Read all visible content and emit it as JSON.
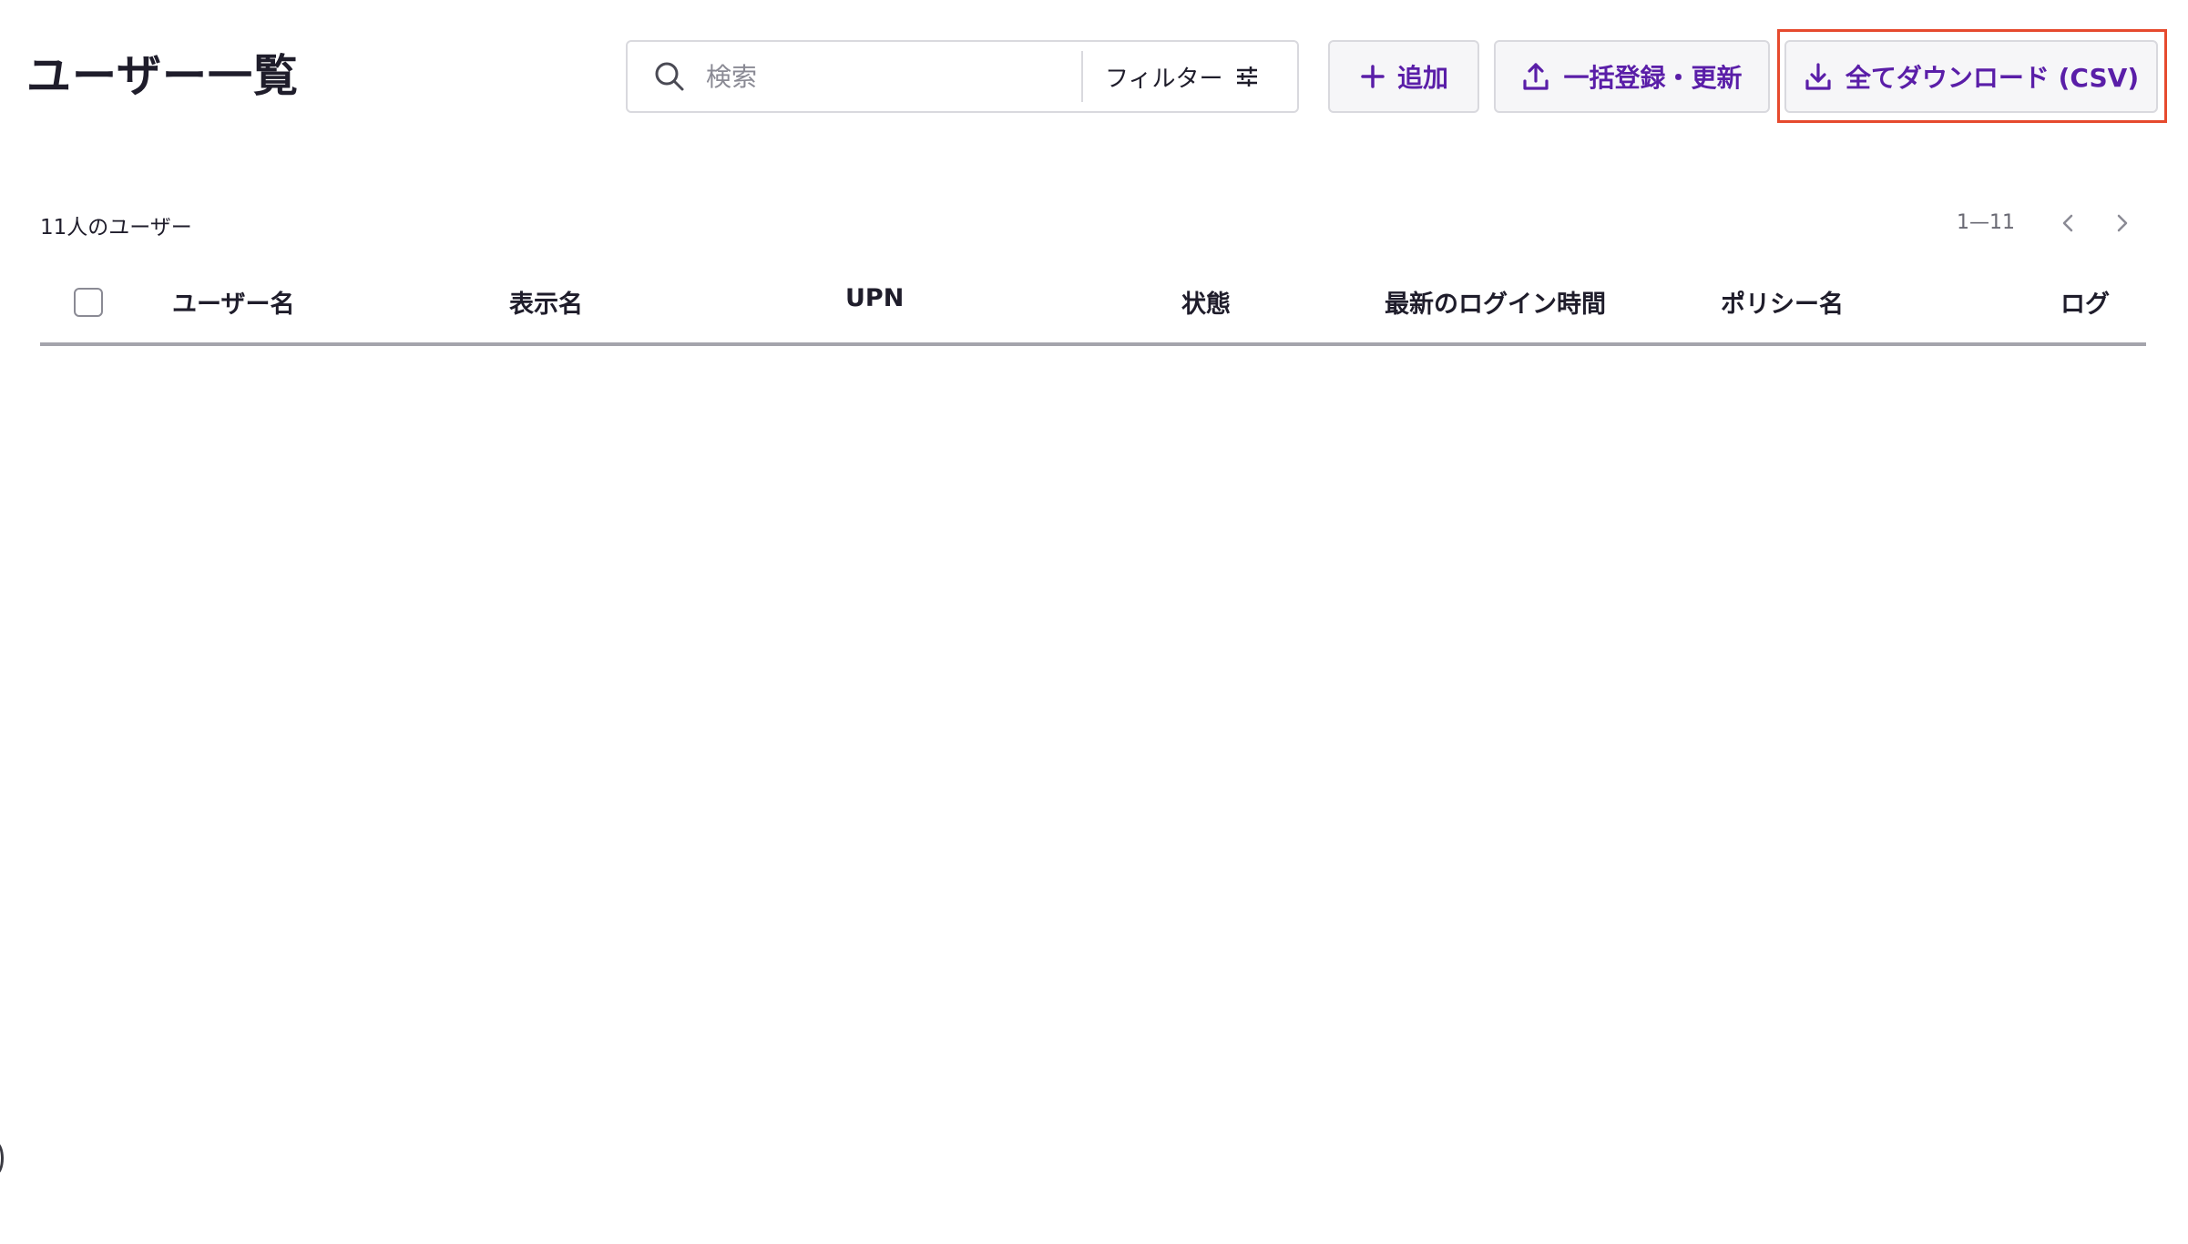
{
  "header": {
    "title": "ユーザー一覧"
  },
  "search": {
    "placeholder": "検索",
    "value": "",
    "filter_label": "フィルター"
  },
  "actions": {
    "add_label": "追加",
    "bulk_label": "一括登録・更新",
    "download_label": "全てダウンロード (CSV)"
  },
  "summary": {
    "user_count": "11人のユーザー",
    "range": "1—11"
  },
  "table": {
    "columns": [
      "ユーザー名",
      "表示名",
      "UPN",
      "状態",
      "最新のログイン時間",
      "ポリシー名",
      "ログ"
    ]
  },
  "colors": {
    "accent": "#5a1ea8",
    "highlight": "#e64a2e",
    "border": "#d9d9de",
    "text": "#1f1d2b"
  },
  "icons": {
    "search": "search-icon",
    "filter": "sliders-icon",
    "add": "plus-icon",
    "upload": "upload-icon",
    "download": "download-icon",
    "prev": "chevron-left-icon",
    "next": "chevron-right-icon"
  }
}
